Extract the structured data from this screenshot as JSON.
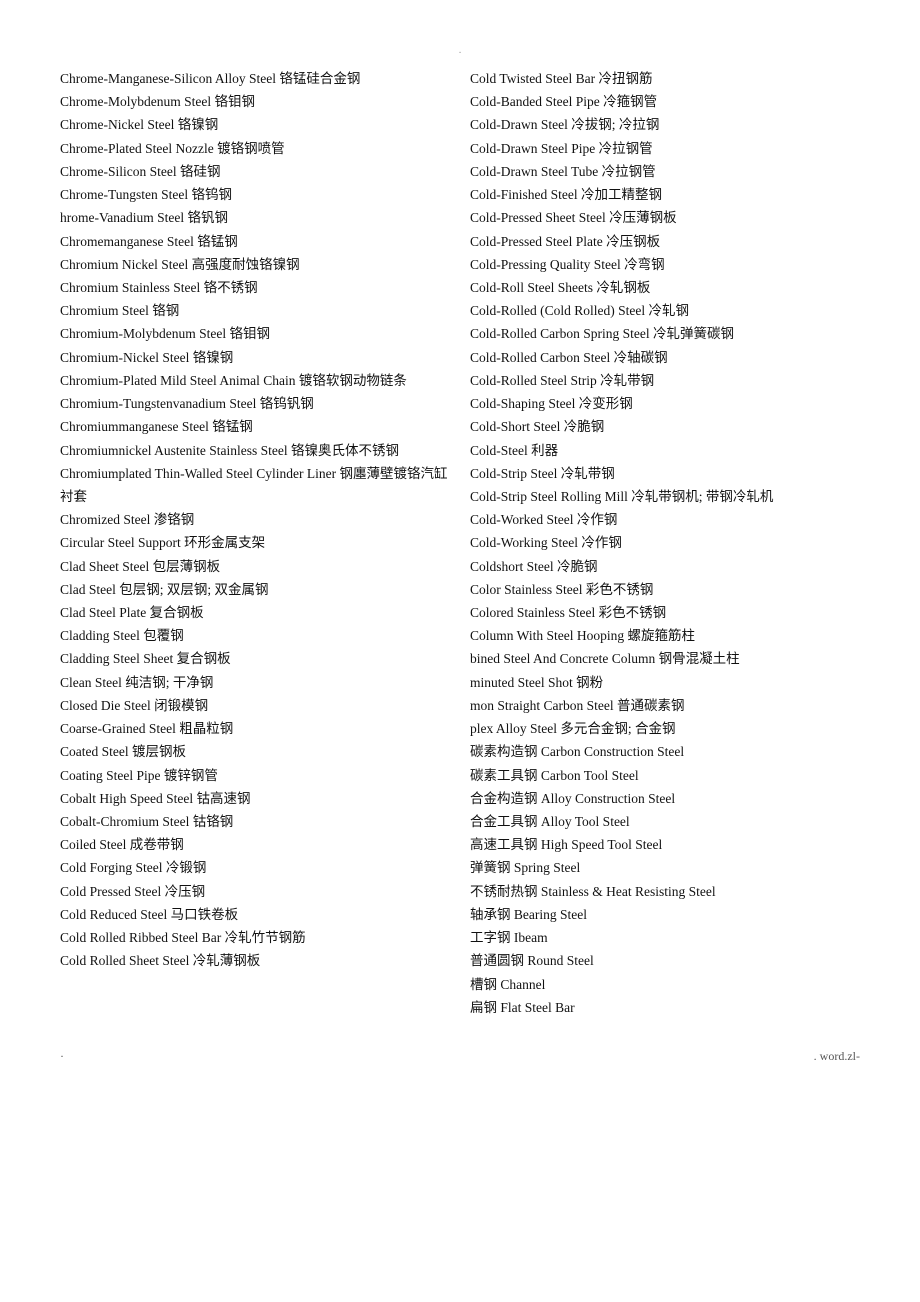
{
  "page": {
    "dot_top": "·",
    "left_col": [
      "Chrome-Manganese-Silicon Alloy Steel  铬锰硅合金钢",
      "Chrome-Molybdenum Steel  铬钼钢",
      "Chrome-Nickel Steel  铬镍钢",
      "Chrome-Plated Steel Nozzle  镀铬钢喷管",
      "Chrome-Silicon Steel  铬硅钢",
      "Chrome-Tungsten Steel  铬钨钢",
      "hrome-Vanadium Steel  铬钒钢",
      "Chromemanganese Steel  铬锰钢",
      "Chromium Nickel Steel  高强度耐蚀铬镍钢",
      "Chromium Stainless Steel  铬不锈钢",
      "Chromium Steel  铬钢",
      "Chromium-Molybdenum Steel  铬钼钢",
      "Chromium-Nickel Steel  铬镍钢",
      "Chromium-Plated Mild Steel Animal Chain  镀铬软钢动物链条",
      "Chromium-Tungstenvanadium Steel  铬钨钒钢",
      "Chromiummanganese Steel  铬锰钢",
      "Chromiumnickel  Austenite  Stainless  Steel  铬镍奥氏体不锈钢",
      "Chromiumplated Thin-Walled Steel Cylinder Liner  钢廛薄壁镀铬汽缸衬套",
      "Chromized Steel  渗铬钢",
      "Circular Steel Support  环形金属支架",
      "Clad Sheet Steel  包层薄钢板",
      "Clad Steel  包层钢; 双层钢; 双金属钢",
      "Clad Steel Plate  复合钢板",
      "Cladding Steel  包覆钢",
      "Cladding Steel Sheet  复合钢板",
      "Clean Steel  纯洁钢; 干净钢",
      "Closed Die Steel  闭锻模钢",
      "Coarse-Grained Steel  粗晶粒钢",
      "Coated Steel  镀层钢板",
      "Coating Steel Pipe  镀锌钢管",
      "Cobalt High Speed Steel  钴高速钢",
      "Cobalt-Chromium Steel  钴铬钢",
      "Coiled Steel  成卷带钢",
      "Cold Forging Steel  冷锻钢",
      "Cold Pressed Steel  冷压钢",
      "Cold Reduced Steel  马口铁卷板",
      "Cold Rolled Ribbed Steel Bar  冷轧竹节钢筋",
      "Cold Rolled Sheet Steel  冷轧薄钢板"
    ],
    "right_col": [
      "Cold Twisted Steel Bar  冷扭钢筋",
      "Cold-Banded Steel Pipe  冷箍钢管",
      "Cold-Drawn Steel  冷拔钢; 冷拉钢",
      "Cold-Drawn Steel Pipe  冷拉钢管",
      "Cold-Drawn Steel Tube  冷拉钢管",
      "Cold-Finished Steel  冷加工精整钢",
      "Cold-Pressed Sheet Steel  冷压薄钢板",
      "Cold-Pressed Steel Plate  冷压钢板",
      "Cold-Pressing Quality Steel  冷弯钢",
      "Cold-Roll Steel Sheets  冷轧钢板",
      "Cold-Rolled (Cold Rolled) Steel  冷轧钢",
      "Cold-Rolled Carbon Spring Steel  冷轧弹簧碳钢",
      "Cold-Rolled Carbon Steel  冷轴碳钢",
      "Cold-Rolled Steel Strip  冷轧带钢",
      "Cold-Shaping Steel  冷变形钢",
      "Cold-Short Steel  冷脆钢",
      "Cold-Steel  利器",
      "Cold-Strip Steel  冷轧带钢",
      "Cold-Strip Steel Rolling Mill  冷轧带钢机; 带钢冷轧机",
      "Cold-Worked Steel  冷作钢",
      "Cold-Working Steel  冷作钢",
      "Coldshort Steel  冷脆钢",
      "Color Stainless Steel  彩色不锈钢",
      "Colored Stainless Steel  彩色不锈钢",
      "Column With Steel Hooping  螺旋箍筋柱",
      "bined Steel And Concrete Column  钢骨混凝土柱",
      "minuted Steel Shot  钢粉",
      "mon Straight Carbon Steel  普通碳素钢",
      "plex Alloy Steel  多元合金钢; 合金钢",
      "碳素构造钢  Carbon Construction Steel",
      "碳素工具钢  Carbon Tool Steel",
      "合金构造钢  Alloy Construction Steel",
      "合金工具钢  Alloy Tool Steel",
      "高速工具钢  High Speed Tool Steel",
      "弹簧钢  Spring Steel",
      "不锈耐热钢  Stainless & Heat Resisting Steel",
      "轴承钢  Bearing Steel",
      "工字钢  Ibeam",
      "普通圆钢  Round Steel",
      "槽钢  Channel",
      "扁钢  Flat Steel Bar"
    ],
    "footer_left": "·",
    "footer_right": ". word.zl-"
  }
}
